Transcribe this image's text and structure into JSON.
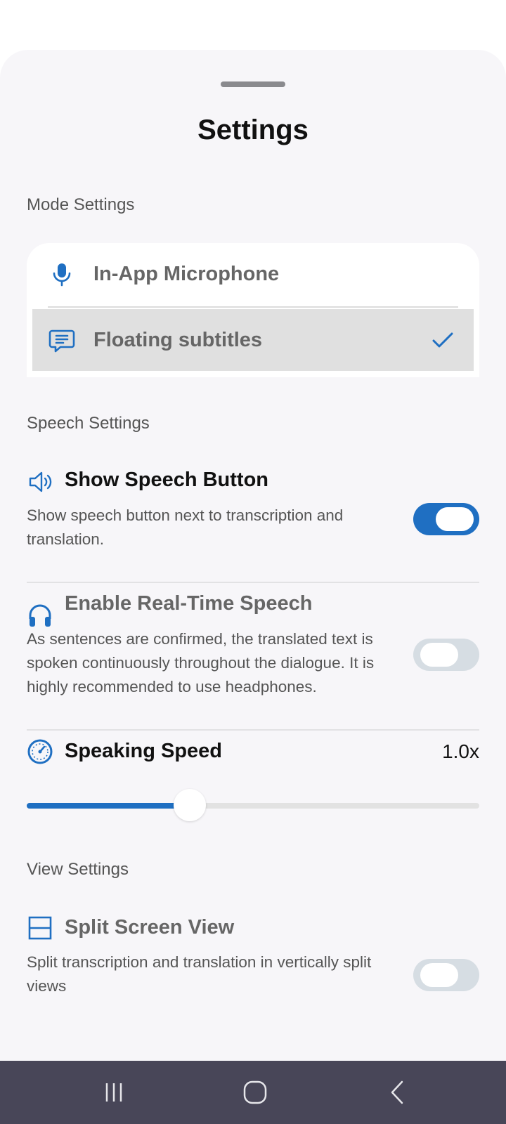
{
  "sheet": {
    "title": "Settings"
  },
  "mode_settings": {
    "label": "Mode Settings",
    "options": [
      {
        "label": "In-App Microphone",
        "icon": "microphone-icon",
        "selected": false
      },
      {
        "label": "Floating subtitles",
        "icon": "subtitles-icon",
        "selected": true
      }
    ]
  },
  "speech_settings": {
    "label": "Speech Settings",
    "show_speech_button": {
      "title": "Show Speech Button",
      "description": "Show speech button next to transcription and translation.",
      "icon": "speaker-icon",
      "enabled": true
    },
    "real_time_speech": {
      "title": "Enable Real-Time Speech",
      "description": "As sentences are confirmed, the translated text is spoken continuously throughout the dialogue. It is highly recommended to use headphones.",
      "icon": "headphones-icon",
      "enabled": false
    },
    "speaking_speed": {
      "title": "Speaking Speed",
      "value_label": "1.0x",
      "icon": "speedometer-icon",
      "slider_fraction": 0.36
    }
  },
  "view_settings": {
    "label": "View Settings",
    "split_screen": {
      "title": "Split Screen View",
      "description": "Split transcription and translation in vertically split views",
      "icon": "split-view-icon",
      "enabled": false
    }
  },
  "navbar": {
    "buttons": [
      "recent-apps-button",
      "home-button",
      "back-button"
    ]
  },
  "colors": {
    "accent": "#1f6fc2",
    "sheet_bg": "#f7f6f9",
    "navbar_bg": "#484658",
    "selected_row": "#e0e0e0"
  }
}
